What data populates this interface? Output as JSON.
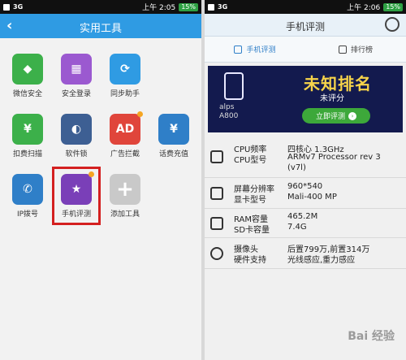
{
  "left": {
    "status": {
      "network": "3G",
      "time": "上午 2:05",
      "battery": "15%"
    },
    "header": {
      "back_icon": "back-arrow-icon",
      "title": "实用工具"
    },
    "tiles": [
      {
        "label": "微信安全",
        "icon": "wechat-shield-icon",
        "color": "#3cb04a"
      },
      {
        "label": "安全登录",
        "icon": "qr-login-icon",
        "color": "#9b59d0"
      },
      {
        "label": "同步助手",
        "icon": "sync-icon",
        "color": "#2f9be3"
      },
      {
        "label": "扣费扫描",
        "icon": "yuan-scan-icon",
        "color": "#3cb04a"
      },
      {
        "label": "软件锁",
        "icon": "lock-icon",
        "color": "#3d5f93"
      },
      {
        "label": "广告拦截",
        "icon": "ad-block-icon",
        "color": "#e0453b"
      },
      {
        "label": "话费充值",
        "icon": "recharge-icon",
        "color": "#2f7fc8"
      },
      {
        "label": "IP拨号",
        "icon": "phone-icon",
        "color": "#2f7fc8"
      },
      {
        "label": "手机评测",
        "icon": "phone-test-icon",
        "color": "#7a3fb8"
      },
      {
        "label": "添加工具",
        "icon": "plus-icon",
        "color": "#c9c9c9"
      }
    ]
  },
  "right": {
    "status": {
      "network": "3G",
      "time": "上午 2:06",
      "battery": "15%"
    },
    "header": {
      "title": "手机评测",
      "search_icon": "search-icon"
    },
    "tabs": [
      {
        "label": "手机评测",
        "active": true
      },
      {
        "label": "排行榜",
        "active": false
      }
    ],
    "banner": {
      "rank": "未知排名",
      "score": "未评分",
      "model_line1": "alps",
      "model_line2": "A800",
      "button": "立即评测",
      "button_arrow": "›"
    },
    "specs": [
      {
        "icon": "cpu-icon",
        "label1": "CPU频率",
        "label2": "CPU型号",
        "value1": "四核心 1.3GHz",
        "value2": "ARMv7 Processor rev 3",
        "value3": "(v7l)"
      },
      {
        "icon": "gpu-icon",
        "label1": "屏幕分辨率",
        "label2": "显卡型号",
        "value1": "960*540",
        "value2": "Mali-400 MP"
      },
      {
        "icon": "memory-icon",
        "label1": "RAM容量",
        "label2": "SD卡容量",
        "value1": "465.2M",
        "value2": "7.4G"
      },
      {
        "icon": "camera-icon",
        "label1": "摄像头",
        "label2": "硬件支持",
        "value1": "后置799万,前置314万",
        "value2": "光线感应,重力感应"
      }
    ],
    "watermark": "Bai 经验"
  }
}
